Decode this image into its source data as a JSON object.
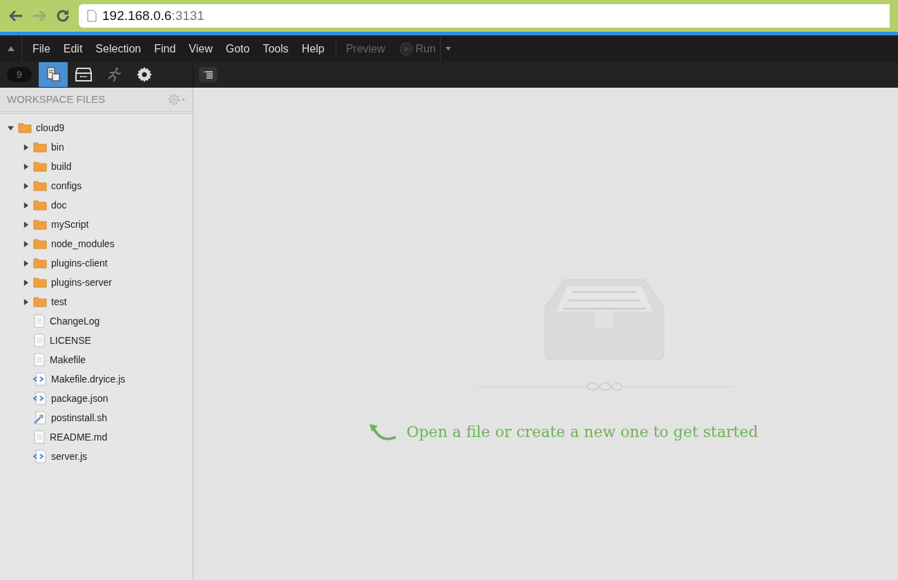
{
  "browser": {
    "url_host": "192.168.0.6",
    "url_port": ":3131"
  },
  "menu": [
    "File",
    "Edit",
    "Selection",
    "Find",
    "View",
    "Goto",
    "Tools",
    "Help"
  ],
  "run_buttons": [
    {
      "label": "Preview",
      "disabled": true,
      "kind": "text"
    },
    {
      "label": "Run",
      "disabled": true,
      "kind": "run"
    }
  ],
  "logo": "9",
  "tools": [
    {
      "kind": "files",
      "selected": true
    },
    {
      "kind": "drawer",
      "selected": false
    },
    {
      "kind": "runner",
      "selected": false,
      "disabled": true
    },
    {
      "kind": "gear",
      "selected": false
    }
  ],
  "sidebar": {
    "title": "WORKSPACE FILES",
    "tree": [
      {
        "name": "cloud9",
        "kind": "folder",
        "expanded": true,
        "children": [
          {
            "name": "bin",
            "kind": "folder",
            "expanded": false
          },
          {
            "name": "build",
            "kind": "folder",
            "expanded": false
          },
          {
            "name": "configs",
            "kind": "folder",
            "expanded": false
          },
          {
            "name": "doc",
            "kind": "folder",
            "expanded": false
          },
          {
            "name": "myScript",
            "kind": "folder",
            "expanded": false
          },
          {
            "name": "node_modules",
            "kind": "folder",
            "expanded": false
          },
          {
            "name": "plugins-client",
            "kind": "folder",
            "expanded": false
          },
          {
            "name": "plugins-server",
            "kind": "folder",
            "expanded": false
          },
          {
            "name": "test",
            "kind": "folder",
            "expanded": false
          },
          {
            "name": "ChangeLog",
            "kind": "text"
          },
          {
            "name": "LICENSE",
            "kind": "text"
          },
          {
            "name": "Makefile",
            "kind": "text"
          },
          {
            "name": "Makefile.dryice.js",
            "kind": "code"
          },
          {
            "name": "package.json",
            "kind": "code"
          },
          {
            "name": "postinstall.sh",
            "kind": "script"
          },
          {
            "name": "README.md",
            "kind": "text"
          },
          {
            "name": "server.js",
            "kind": "code"
          }
        ]
      }
    ]
  },
  "empty_state": {
    "message": "Open a file or create a new one to get started"
  }
}
